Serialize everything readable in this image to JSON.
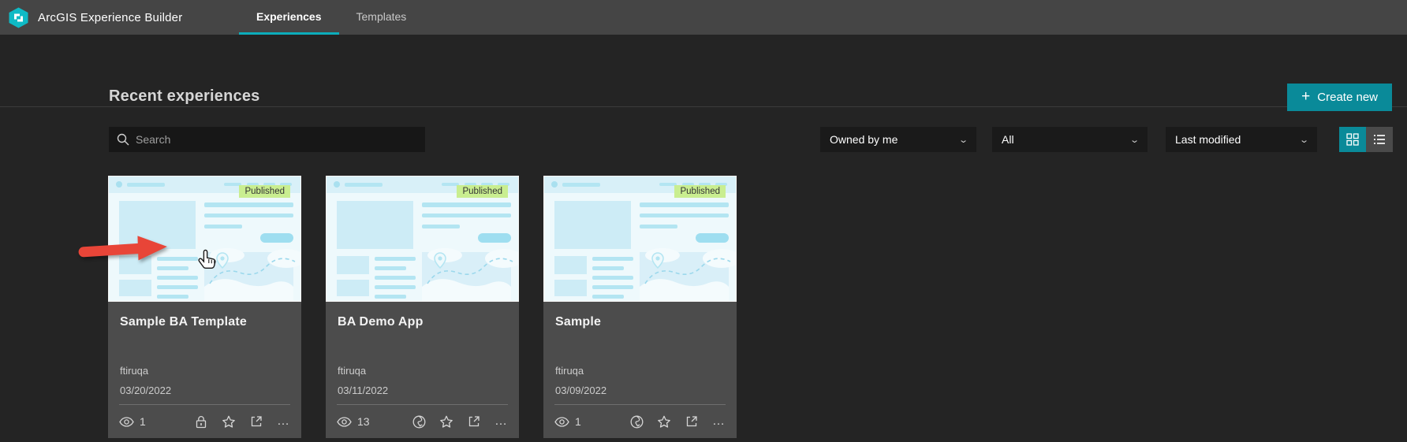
{
  "colors": {
    "accent_teal": "#0a8a99",
    "tab_underline": "#0cadbb",
    "nav_bg": "#454545",
    "page_bg": "#242424",
    "card_bg": "#4c4c4c",
    "badge_bg": "#c9ee90",
    "arrow_red": "#e84538"
  },
  "nav": {
    "app_title": "ArcGIS Experience Builder",
    "logo_icon": "experience-builder-logo",
    "tabs": [
      {
        "label": "Experiences",
        "active": true
      },
      {
        "label": "Templates",
        "active": false
      }
    ]
  },
  "header": {
    "title": "Recent experiences",
    "create_button": {
      "plus": "+",
      "label": "Create new"
    }
  },
  "toolbar": {
    "search": {
      "placeholder": "Search",
      "icon": "search-icon"
    },
    "filters": [
      {
        "value": "Owned by me"
      },
      {
        "value": "All"
      },
      {
        "value": "Last modified"
      }
    ],
    "view_modes": [
      {
        "icon": "grid-view-icon",
        "active": true
      },
      {
        "icon": "list-view-icon",
        "active": false
      }
    ]
  },
  "cards": [
    {
      "title": "Sample BA Template",
      "status": "Published",
      "owner": "ftiruqa",
      "date": "03/20/2022",
      "views": "1",
      "share": "lock",
      "icons": [
        "eye-icon",
        "lock-icon",
        "star-icon",
        "export-icon",
        "ellipsis-icon"
      ]
    },
    {
      "title": "BA Demo App",
      "status": "Published",
      "owner": "ftiruqa",
      "date": "03/11/2022",
      "views": "13",
      "share": "globe",
      "icons": [
        "eye-icon",
        "globe-icon",
        "star-icon",
        "export-icon",
        "ellipsis-icon"
      ]
    },
    {
      "title": "Sample",
      "status": "Published",
      "owner": "ftiruqa",
      "date": "03/09/2022",
      "views": "1",
      "share": "globe",
      "icons": [
        "eye-icon",
        "globe-icon",
        "star-icon",
        "export-icon",
        "ellipsis-icon"
      ]
    }
  ],
  "annotation": {
    "arrow": "red-arrow-pointing-at-first-card",
    "cursor": "hand-cursor"
  },
  "ellipsis_glyph": "· · ·"
}
